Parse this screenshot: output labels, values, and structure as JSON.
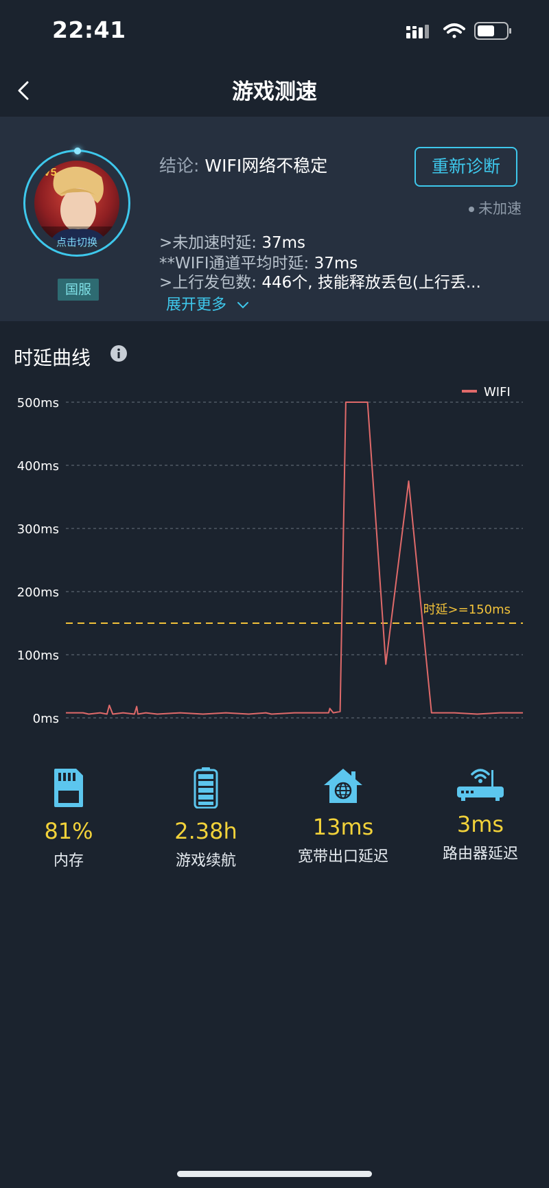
{
  "status_bar": {
    "time": "22:41"
  },
  "nav": {
    "title": "游戏测速"
  },
  "diagnosis": {
    "avatar_caption": "点击切换",
    "region": "国服",
    "conclusion_label": "结论: ",
    "conclusion_value": "WIFI网络不稳定",
    "rediagnose_label": "重新诊断",
    "accel_status": "未加速",
    "details": [
      {
        "label": ">未加速时延: ",
        "value": "37ms"
      },
      {
        "label": "**WIFI通道平均时延: ",
        "value": "37ms"
      },
      {
        "label": ">上行发包数: ",
        "value": "446个, 技能释放丢包(上行丢..."
      }
    ],
    "expand_label": "展开更多"
  },
  "chart_section": {
    "title": "时延曲线"
  },
  "chart_data": {
    "type": "line",
    "ylim": [
      0,
      500
    ],
    "y_ticks": [
      "0ms",
      "100ms",
      "200ms",
      "300ms",
      "400ms",
      "500ms"
    ],
    "y_tick_values": [
      0,
      100,
      200,
      300,
      400,
      500
    ],
    "threshold": {
      "value": 150,
      "label": "时延>=150ms",
      "color": "#f2c23a"
    },
    "legend_position": "top-right",
    "grid": true,
    "series": [
      {
        "name": "WIFI",
        "color": "#e06a6a",
        "x": [
          0,
          15,
          20,
          30,
          36,
          38,
          41,
          50,
          60,
          62,
          63,
          70,
          80,
          100,
          120,
          140,
          160,
          175,
          180,
          200,
          220,
          230,
          231,
          234,
          240,
          245,
          250,
          255,
          262,
          264,
          280,
          300,
          320,
          340,
          360,
          380,
          400
        ],
        "values": [
          8,
          8,
          6,
          8,
          6,
          20,
          6,
          8,
          6,
          18,
          6,
          8,
          6,
          8,
          6,
          8,
          6,
          8,
          6,
          8,
          8,
          8,
          15,
          8,
          10,
          500,
          500,
          500,
          500,
          500,
          85,
          375,
          8,
          8,
          6,
          8,
          8
        ]
      }
    ]
  },
  "stats": [
    {
      "value": "81%",
      "label": "内存"
    },
    {
      "value": "2.38h",
      "label": "游戏续航"
    },
    {
      "value": "13ms",
      "label": "宽带出口延迟"
    },
    {
      "value": "3ms",
      "label": "路由器延迟"
    }
  ]
}
